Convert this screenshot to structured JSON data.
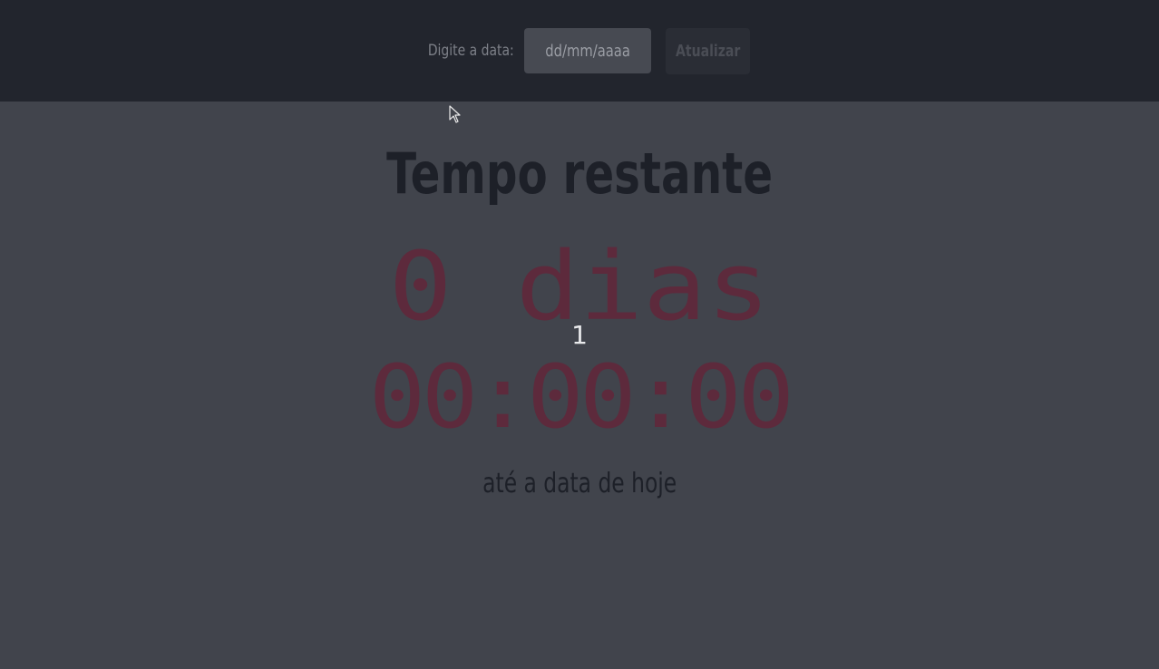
{
  "header": {
    "date_label": "Digite a data:",
    "date_placeholder": "dd/mm/aaaa",
    "update_label": "Atualizar"
  },
  "main": {
    "title": "Tempo restante",
    "days_text": "0 dias",
    "small_number": "1",
    "clock_text": "00:00:00",
    "subtitle": "até a data de hoje"
  },
  "colors": {
    "topbar_bg": "#22252d",
    "page_bg": "#41444c",
    "accent": "#5d2a3c",
    "title_text": "#1d2028"
  },
  "icons": {
    "cursor": "mouse-pointer-icon"
  }
}
